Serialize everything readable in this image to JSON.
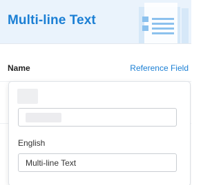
{
  "header": {
    "title": "Multi-line Text",
    "illustration_icon": "document-lines-icon",
    "accent_color": "#1b7fd4",
    "background_color": "#eaf3fc"
  },
  "field": {
    "label": "Name",
    "reference_link": "Reference Field"
  },
  "popover": {
    "default_value": "",
    "language_label": "English",
    "language_value": "Multi-line Text"
  }
}
